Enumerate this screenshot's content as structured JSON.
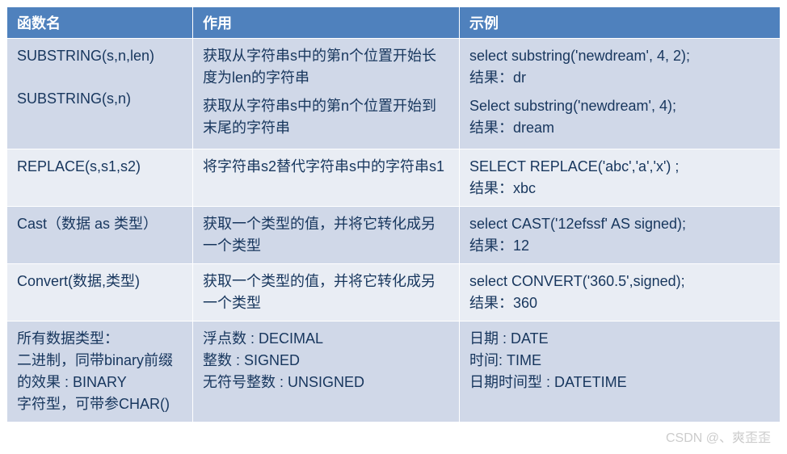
{
  "headers": {
    "c0": "函数名",
    "c1": "作用",
    "c2": "示例"
  },
  "rows": [
    {
      "name_a": "SUBSTRING(s,n,len)",
      "desc_a": "获取从字符串s中的第n个位置开始长度为len的字符串",
      "ex_a_1": "select substring('newdream', 4, 2);",
      "ex_a_2": "结果：dr",
      "name_b": "SUBSTRING(s,n)",
      "desc_b": "获取从字符串s中的第n个位置开始到末尾的字符串",
      "ex_b_1": "Select substring('newdream', 4);",
      "ex_b_2": "结果：dream"
    },
    {
      "name": "REPLACE(s,s1,s2)",
      "desc": "将字符串s2替代字符串s中的字符串s1",
      "ex_1": "SELECT REPLACE('abc','a','x') ;",
      "ex_2": "结果：xbc"
    },
    {
      "name": "Cast（数据 as  类型）",
      "desc": "获取一个类型的值，并将它转化成另一个类型",
      "ex_1": "select  CAST('12efssf' AS signed);",
      "ex_2": "结果：12"
    },
    {
      "name": "Convert(数据,类型)",
      "desc": "获取一个类型的值，并将它转化成另一个类型",
      "ex_1": "select CONVERT('360.5',signed);",
      "ex_2": "结果：360"
    },
    {
      "name_l1": "所有数据类型：",
      "name_l2": "二进制，同带binary前缀的效果 : BINARY",
      "name_l3": " 字符型，可带参CHAR()",
      "desc_l1": "浮点数 : DECIMAL",
      "desc_l2": "整数 : SIGNED",
      "desc_l3": "无符号整数 : UNSIGNED",
      "ex_l1": "日期 : DATE",
      "ex_l2": "时间: TIME",
      "ex_l3": "日期时间型 : DATETIME"
    }
  ],
  "watermark": "CSDN @、爽歪歪"
}
